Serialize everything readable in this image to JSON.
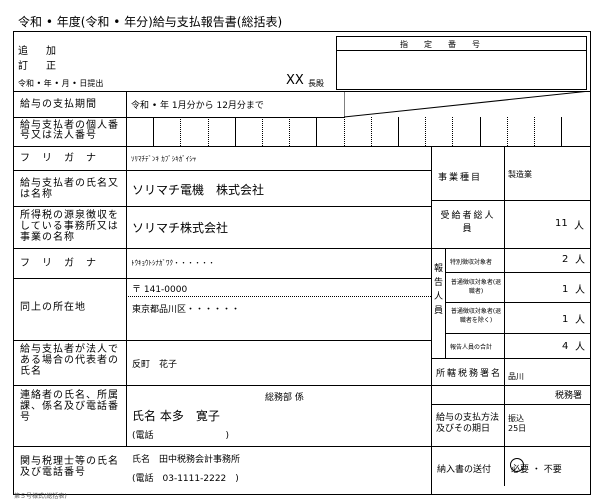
{
  "form": {
    "title": "令和 • 年度(令和 • 年分)給与支払報告書(総括表)",
    "add_label": "追　加",
    "correct_label": "訂　正",
    "submit_date": "令和 • 年 • 月 • 日提出",
    "recipient": "XX",
    "recipient_suffix": "長殿",
    "designated_number_label": "指　定　番　号",
    "period_label": "給与の支払期間",
    "period_value": "令和 • 年 1月分から 12月分まで",
    "id_label": "給与支払者の個人番号又は法人番号",
    "furigana_label": "フ　リ　ガ　ナ",
    "payer_furigana": "ｿﾘﾏﾁﾃﾞﾝｷ ｶﾌﾞｼｷｶﾞｲｼｬ",
    "payer_name_label": "給与支払者の氏名又は名称",
    "payer_name": "ソリマチ電機　株式会社",
    "office_label": "所得税の源泉徴収をしている事務所又は事業の名称",
    "office_name": "ソリマチ株式会社",
    "address_furigana_label": "フ　リ　ガ　ナ",
    "address_furigana": "ﾄｳｷｮｳﾄｼﾅｶﾞﾜｸ・・・・・・",
    "address_label": "同上の所在地",
    "postal": "〒 141-0000",
    "address": "東京都品川区・・・・・・",
    "rep_label": "給与支払者が法人である場合の代表者の氏名",
    "rep_name": "反町　花子",
    "contact_label": "連絡者の氏名、所属課、係名及び電話番号",
    "contact_dept": "総務部 係",
    "contact_name": "氏名 本多　寛子",
    "contact_phone": "(電話　　　　　　　　)",
    "tax_label": "関与税理士等の氏名及び電話番号",
    "tax_name": "氏名　田中税務会計事務所",
    "tax_phone": "(電話　03-1111-2222　)",
    "biz_type_label": "事業種目",
    "biz_type": "製造業",
    "total_label": "受給者総人員",
    "total_value": "11",
    "person_unit": "人",
    "report_label": "報告人員",
    "row1_label": "特別徴収対象者",
    "row1_value": "2",
    "row2_label": "普通徴収対象者(退職者)",
    "row2_value": "1",
    "row3_label": "普通徴収対象者(退職者を除く)",
    "row3_value": "1",
    "row4_label": "報告人員の合計",
    "row4_value": "4",
    "office_tax_label": "所轄税務署名",
    "office_tax_value1": "品川",
    "office_tax_value2": "税務署",
    "payday_label": "給与の支払方法及びその期日",
    "payday_value1": "振込",
    "payday_value2": "25日",
    "mail_label": "納入書の送付",
    "mail_value": "必要 ・ 不要",
    "footer": "●",
    "footer_note": "第５号様式(総括表)"
  }
}
